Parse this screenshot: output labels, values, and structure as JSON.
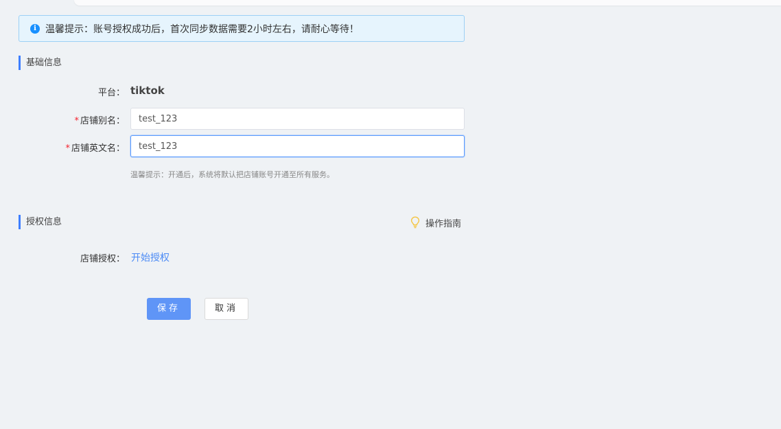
{
  "notice": {
    "text": "温馨提示：账号授权成功后，首次同步数据需要2小时左右，请耐心等待！",
    "icon": "info-icon"
  },
  "basic_section": {
    "title": "基础信息"
  },
  "form": {
    "platform_label": "平台：",
    "platform_value": "tiktok",
    "alias_label": "店铺别名：",
    "alias_value": "test_123",
    "english_label": "店铺英文名：",
    "english_value": "test_123",
    "hint": "温馨提示：开通后，系统将默认把店铺账号开通至所有服务。"
  },
  "auth_section": {
    "title": "授权信息",
    "guide_label": "操作指南",
    "guide_icon": "lightbulb-icon"
  },
  "auth": {
    "label": "店铺授权：",
    "link": "开始授权"
  },
  "actions": {
    "save": "保存",
    "cancel": "取消"
  },
  "colors": {
    "accent": "#3d7eff",
    "link": "#4c8bf5",
    "required": "#f5222d",
    "notice_bg": "#e6f4fd"
  }
}
